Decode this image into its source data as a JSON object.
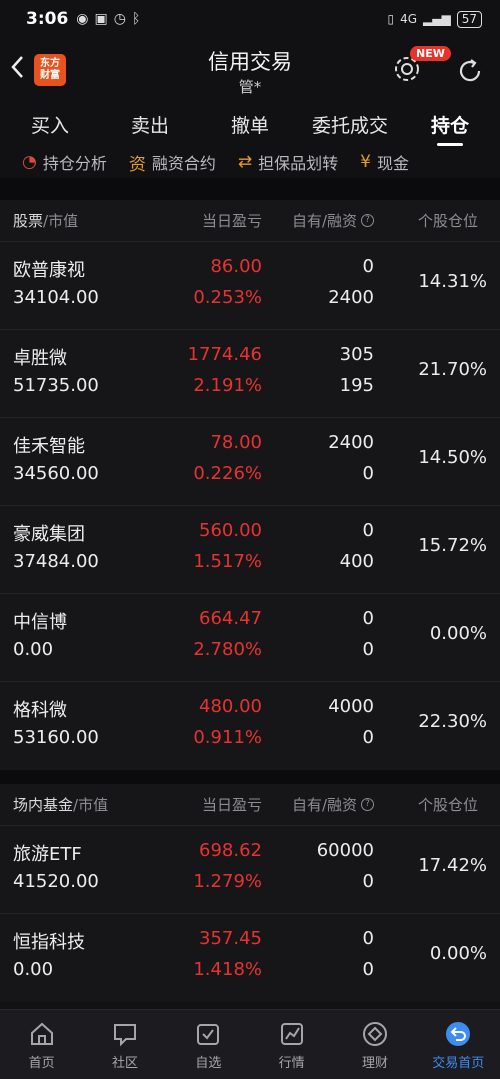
{
  "status": {
    "time": "3:06",
    "battery": "57",
    "signal": "4G"
  },
  "header": {
    "brand": "东方\n财富",
    "title": "信用交易",
    "subtitle": "管*",
    "new_badge": "NEW"
  },
  "tabs": [
    {
      "label": "买入"
    },
    {
      "label": "卖出"
    },
    {
      "label": "撤单"
    },
    {
      "label": "委托成交"
    },
    {
      "label": "持仓"
    }
  ],
  "subtools": [
    {
      "label": "持仓分析",
      "icon": "◔"
    },
    {
      "label": "融资合约",
      "icon": "资"
    },
    {
      "label": "担保品划转",
      "icon": "⇄"
    },
    {
      "label": "现金",
      "icon": "¥"
    }
  ],
  "stocks": {
    "header": {
      "col1": "股票",
      "col1_sub": "/市值",
      "col2": "当日盈亏",
      "col3": "自有/融资",
      "col4": "个股仓位"
    },
    "rows": [
      {
        "name": "欧普康视",
        "market_value": "34104.00",
        "pl": "86.00",
        "pl_pct": "0.253%",
        "own": "0",
        "financed": "2400",
        "position": "14.31%"
      },
      {
        "name": "卓胜微",
        "market_value": "51735.00",
        "pl": "1774.46",
        "pl_pct": "2.191%",
        "own": "305",
        "financed": "195",
        "position": "21.70%"
      },
      {
        "name": "佳禾智能",
        "market_value": "34560.00",
        "pl": "78.00",
        "pl_pct": "0.226%",
        "own": "2400",
        "financed": "0",
        "position": "14.50%"
      },
      {
        "name": "豪威集团",
        "market_value": "37484.00",
        "pl": "560.00",
        "pl_pct": "1.517%",
        "own": "0",
        "financed": "400",
        "position": "15.72%"
      },
      {
        "name": "中信博",
        "market_value": "0.00",
        "pl": "664.47",
        "pl_pct": "2.780%",
        "own": "0",
        "financed": "0",
        "position": "0.00%"
      },
      {
        "name": "格科微",
        "market_value": "53160.00",
        "pl": "480.00",
        "pl_pct": "0.911%",
        "own": "4000",
        "financed": "0",
        "position": "22.30%"
      }
    ]
  },
  "funds": {
    "header": {
      "col1": "场内基金",
      "col1_sub": "/市值",
      "col2": "当日盈亏",
      "col3": "自有/融资",
      "col4": "个股仓位"
    },
    "rows": [
      {
        "name": "旅游ETF",
        "market_value": "41520.00",
        "pl": "698.62",
        "pl_pct": "1.279%",
        "own": "60000",
        "financed": "0",
        "position": "17.42%"
      },
      {
        "name": "恒指科技",
        "market_value": "0.00",
        "pl": "357.45",
        "pl_pct": "1.418%",
        "own": "0",
        "financed": "0",
        "position": "0.00%"
      }
    ]
  },
  "nav": [
    {
      "label": "首页",
      "icon": "home-icon"
    },
    {
      "label": "社区",
      "icon": "chat-icon"
    },
    {
      "label": "自选",
      "icon": "check-box-icon"
    },
    {
      "label": "行情",
      "icon": "chart-icon"
    },
    {
      "label": "理财",
      "icon": "diamond-icon"
    },
    {
      "label": "交易首页",
      "icon": "return-icon"
    }
  ],
  "colors": {
    "accent_red": "#e8322f",
    "active_blue": "#3d8cf0",
    "brand_orange": "#e8521e"
  }
}
